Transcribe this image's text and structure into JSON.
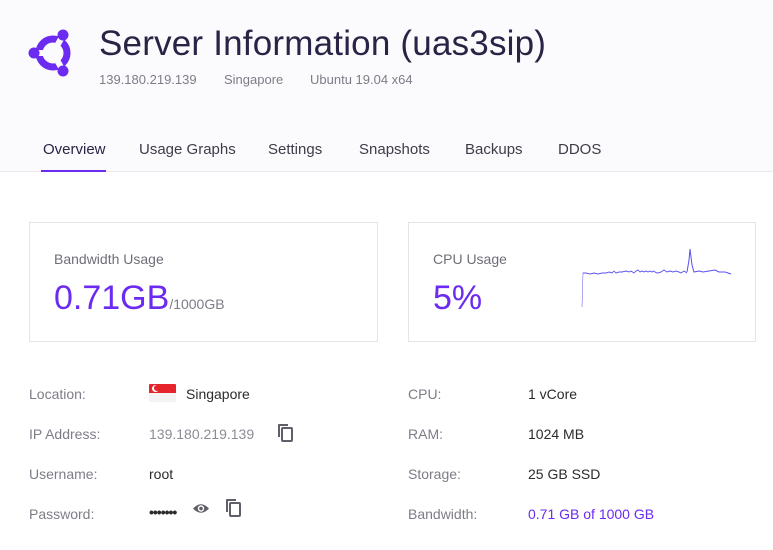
{
  "header": {
    "title": "Server Information (uas3sip)",
    "ip": "139.180.219.139",
    "location": "Singapore",
    "os": "Ubuntu 19.04 x64",
    "logo_icon": "ubuntu-logo-icon",
    "accent_color": "#6b2bf0"
  },
  "tabs": [
    {
      "label": "Overview",
      "active": true
    },
    {
      "label": "Usage Graphs",
      "active": false
    },
    {
      "label": "Settings",
      "active": false
    },
    {
      "label": "Snapshots",
      "active": false
    },
    {
      "label": "Backups",
      "active": false
    },
    {
      "label": "DDOS",
      "active": false
    }
  ],
  "bandwidth_card": {
    "label": "Bandwidth Usage",
    "value": "0.71GB",
    "unit": "/1000GB"
  },
  "cpu_card": {
    "label": "CPU Usage",
    "value": "5%"
  },
  "details_left": {
    "location_label": "Location:",
    "location_value": "Singapore",
    "location_flag_icon": "singapore-flag-icon",
    "ip_label": "IP Address:",
    "ip_value": "139.180.219.139",
    "username_label": "Username:",
    "username_value": "root",
    "password_label": "Password:",
    "password_value": "•••••••"
  },
  "details_right": {
    "cpu_label": "CPU:",
    "cpu_value": "1 vCore",
    "ram_label": "RAM:",
    "ram_value": "1024 MB",
    "storage_label": "Storage:",
    "storage_value": "25 GB SSD",
    "bandwidth_label": "Bandwidth:",
    "bandwidth_value": "0.71 GB of 1000 GB"
  }
}
